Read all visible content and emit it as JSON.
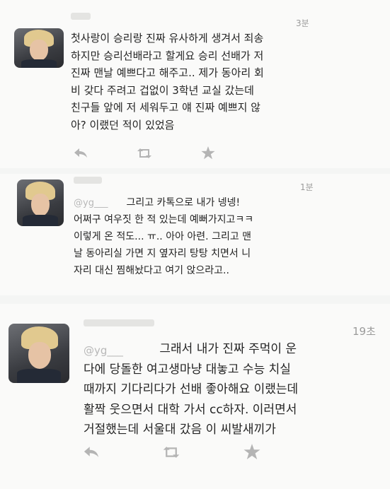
{
  "tweets": [
    {
      "time": "3분",
      "text": "첫사랑이 승리랑 진짜 유사하게 생겨서 죄송\n하지만 승리선배라고 할게요 승리 선배가 저\n진짜 맨날 예쁘다고 해주고.. 제가 동아리 회\n비 갖다 주려고 겁없이 3학년 교실 갔는데\n친구들 앞에 저 세워두고 얘 진짜 예쁘지 않\n아? 이랬던 적이 있었음"
    },
    {
      "time": "1분",
      "mention": "@yg___",
      "text": "      그리고 카톡으로 내가 넹넹!\n어쩌구 여우짓 한 적 있는데 예뻐가지고ㅋㅋ\n이렇게 온 적도... ㅠ.. 아아 아련. 그리고 맨\n날 동아리실 가면 지 옆자리 탕탕 치면서 니\n자리 대신 찜해놨다고 여기 앉으라고.."
    },
    {
      "time": "19초",
      "mention": "@yg___",
      "text": "       그래서 내가 진짜 주먹이 운\n다에 당돌한 여고생마냥 대놓고 수능 치실\n때까지 기다리다가 선배 좋아해요 이랬는데\n활짝 웃으면서 대학 가서 cc하자. 이러면서\n거절했는데 서울대 갔음 이 씨발새끼가"
    }
  ],
  "icons": [
    "reply-icon",
    "retweet-icon",
    "favorite-icon"
  ],
  "colors": {
    "icon": "#b4b4b4",
    "timestamp": "#9a9a9a",
    "text": "#242424"
  }
}
